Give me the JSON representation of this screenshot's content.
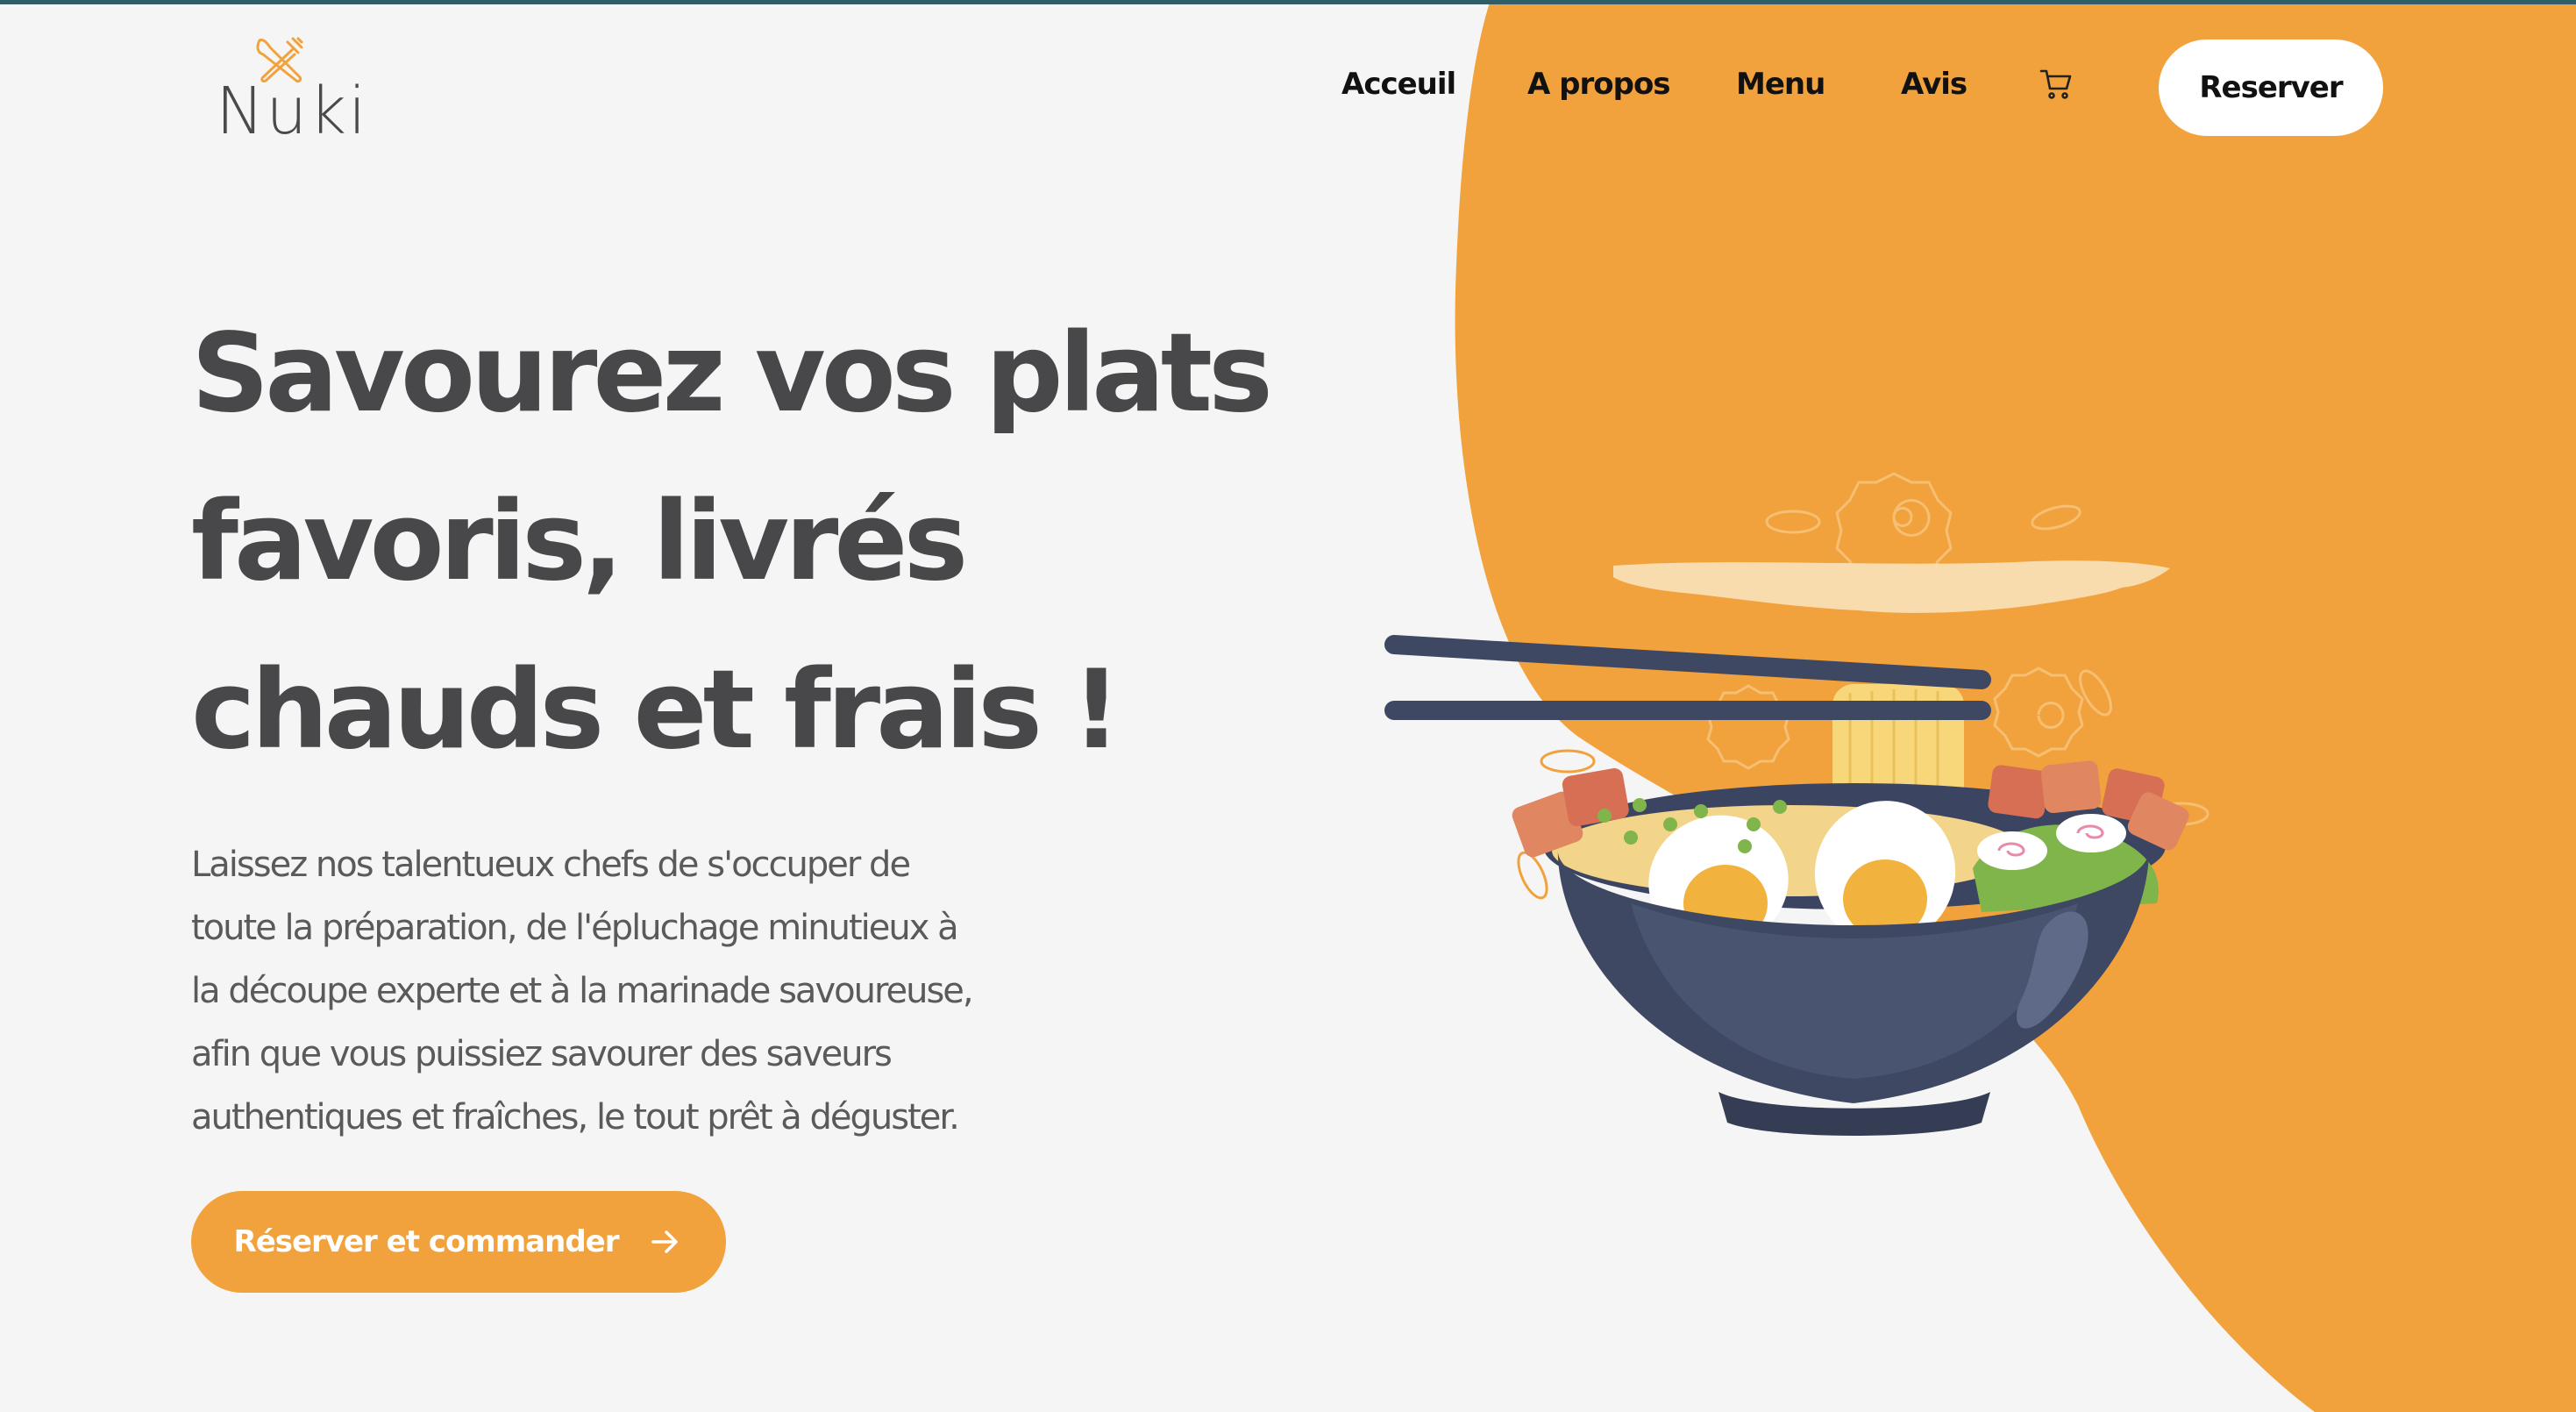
{
  "colors": {
    "accent": "#f2a23c",
    "text_dark": "#48484a",
    "button_bg": "#ffffff",
    "page_bg": "#f5f5f5",
    "bowl": "#3f4862"
  },
  "brand": {
    "name": "Nuki",
    "logo_icon": "crossed-fork-knife-icon"
  },
  "nav": {
    "items": [
      {
        "label": "Acceuil"
      },
      {
        "label": "A propos"
      },
      {
        "label": "Menu"
      },
      {
        "label": "Avis"
      }
    ],
    "cart_icon": "shopping-cart-icon",
    "reserve_label": "Reserver"
  },
  "hero": {
    "title_lines": [
      "Savourez vos plats",
      "favoris, livrés",
      "chauds et frais !"
    ],
    "description_lines": [
      "Laissez nos talentueux chefs de s'occuper de",
      "toute la préparation, de l'épluchage minutieux à",
      "la découpe experte et à la marinade savoureuse,",
      "afin que vous puissiez savourer des saveurs",
      "authentiques et fraîches, le tout prêt à déguster."
    ],
    "cta_label": "Réserver et commander",
    "cta_icon": "arrow-right-icon",
    "illustration": "ramen-bowl-with-chopsticks"
  }
}
